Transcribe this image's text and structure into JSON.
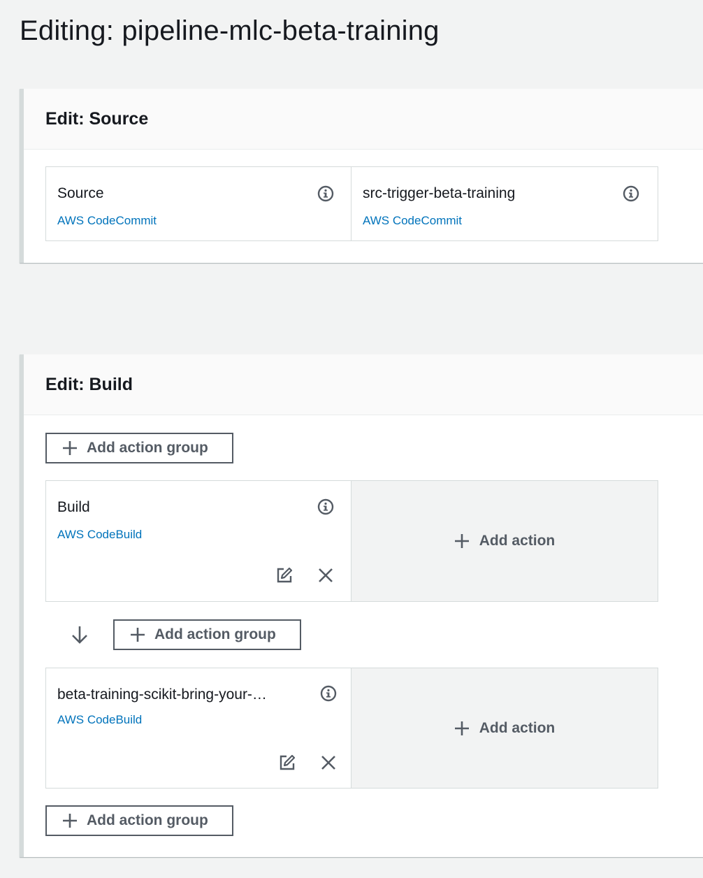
{
  "page": {
    "title": "Editing: pipeline-mlc-beta-training"
  },
  "source_stage": {
    "header": "Edit: Source",
    "actions": [
      {
        "name": "Source",
        "provider": "AWS CodeCommit"
      },
      {
        "name": "src-trigger-beta-training",
        "provider": "AWS CodeCommit"
      }
    ]
  },
  "build_stage": {
    "header": "Edit: Build",
    "add_action_group_label": "Add action group",
    "add_action_label": "Add action",
    "groups": [
      {
        "name": "Build",
        "provider": "AWS CodeBuild"
      },
      {
        "name": "beta-training-scikit-bring-your-…",
        "provider": "AWS CodeBuild"
      }
    ]
  },
  "colors": {
    "link": "#0073bb",
    "background": "#f2f3f3",
    "button_text": "#545b64"
  },
  "icons": [
    "info-icon",
    "plus-icon",
    "edit-icon",
    "close-icon",
    "arrow-down-icon"
  ]
}
